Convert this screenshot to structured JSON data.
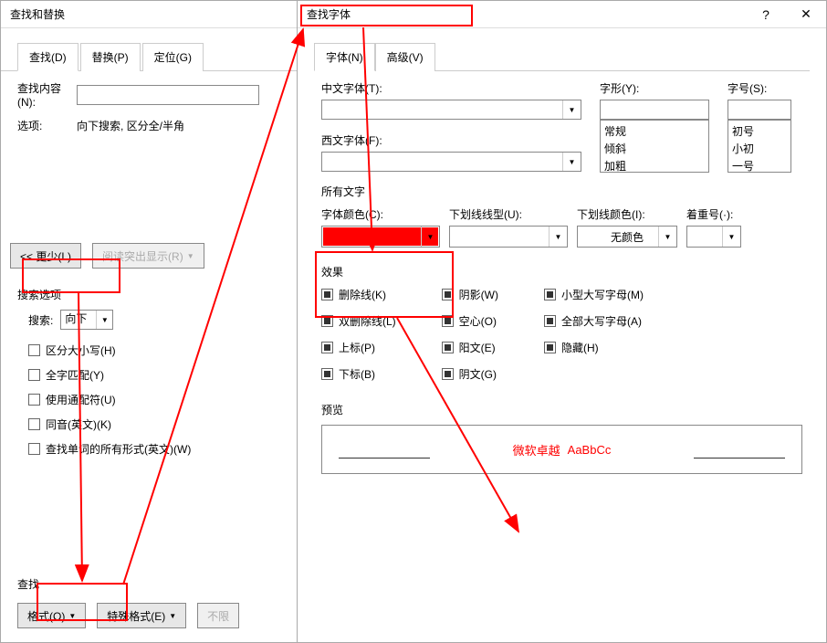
{
  "left_dialog": {
    "title": "查找和替换",
    "tabs": {
      "find": "查找(D)",
      "replace": "替换(P)",
      "goto": "定位(G)"
    },
    "find_content_label": "查找内容(N):",
    "options_label": "选项:",
    "options_value": "向下搜索, 区分全/半角",
    "less_button": "<< 更少(L)",
    "highlight_button": "阅读突出显示(R)",
    "search_options_label": "搜索选项",
    "search_label": "搜索:",
    "search_direction": "向下",
    "checkboxes": {
      "case": "区分大小写(H)",
      "whole_word": "全字匹配(Y)",
      "wildcards": "使用通配符(U)",
      "sounds_like": "同音(英文)(K)",
      "all_forms": "查找单词的所有形式(英文)(W)"
    },
    "find_section_label": "查找",
    "format_button": "格式(O)",
    "special_button": "特殊格式(E)",
    "no_limit_button": "不限"
  },
  "right_dialog": {
    "title": "查找字体",
    "tabs": {
      "font": "字体(N)",
      "advanced": "高级(V)"
    },
    "cn_font_label": "中文字体(T):",
    "western_font_label": "西文字体(F):",
    "style_label": "字形(Y):",
    "size_label": "字号(S):",
    "style_options": [
      "常规",
      "倾斜",
      "加粗"
    ],
    "size_options": [
      "初号",
      "小初",
      "一号"
    ],
    "all_text_label": "所有文字",
    "font_color_label": "字体颜色(C):",
    "underline_style_label": "下划线线型(U):",
    "underline_color_label": "下划线颜色(I):",
    "underline_color_value": "无颜色",
    "emphasis_label": "着重号(·):",
    "effects_label": "效果",
    "effects": {
      "strikethrough": "删除线(K)",
      "double_strikethrough": "双删除线(L)",
      "superscript": "上标(P)",
      "subscript": "下标(B)",
      "shadow": "阴影(W)",
      "outline": "空心(O)",
      "emboss": "阳文(E)",
      "engrave": "阴文(G)",
      "small_caps": "小型大写字母(M)",
      "all_caps": "全部大写字母(A)",
      "hidden": "隐藏(H)"
    },
    "preview_label": "预览",
    "preview_text_cn": "微软卓越",
    "preview_text_en": "AaBbCc",
    "font_color": "#ff0000"
  }
}
